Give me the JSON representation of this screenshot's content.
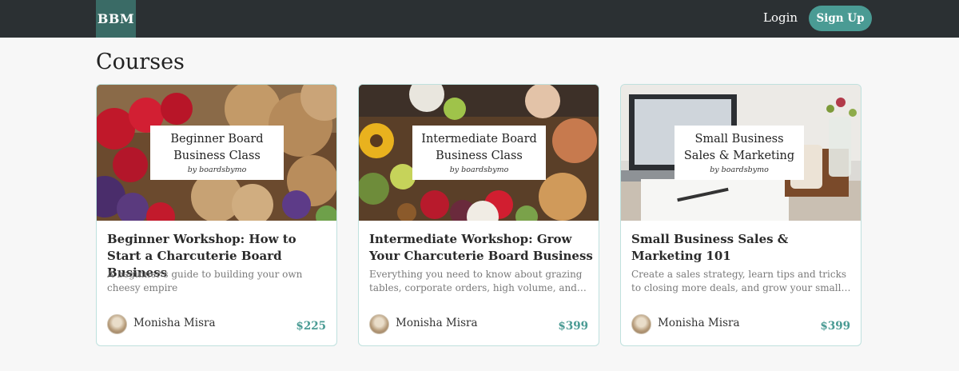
{
  "header": {
    "logo": "BBM",
    "login_label": "Login",
    "signup_label": "Sign Up"
  },
  "page": {
    "title": "Courses"
  },
  "courses": [
    {
      "thumb_title": "Beginner Board\nBusiness Class",
      "thumb_signature": "by boardsbymo",
      "title": "Beginner Workshop: How to Start a Charcuterie Board Business",
      "description": "A beginner's guide to building your own cheesy empire",
      "author": "Monisha Misra",
      "price": "$225"
    },
    {
      "thumb_title": "Intermediate Board\nBusiness Class",
      "thumb_signature": "by boardsbymo",
      "title": "Intermediate Workshop: Grow Your Charcuterie Board Business",
      "description": "Everything you need to know about grazing tables, corporate orders, high volume, and…",
      "author": "Monisha Misra",
      "price": "$399"
    },
    {
      "thumb_title": "Small Business\nSales & Marketing",
      "thumb_signature": "by boardsbymo",
      "title": "Small Business Sales & Marketing 101",
      "description": "Create a sales strategy, learn tips and tricks to closing more deals, and grow your small…",
      "author": "Monisha Misra",
      "price": "$399"
    }
  ],
  "colors": {
    "topbar": "#2b3033",
    "logo_bg": "#3a6b66",
    "accent": "#4a9b94"
  }
}
